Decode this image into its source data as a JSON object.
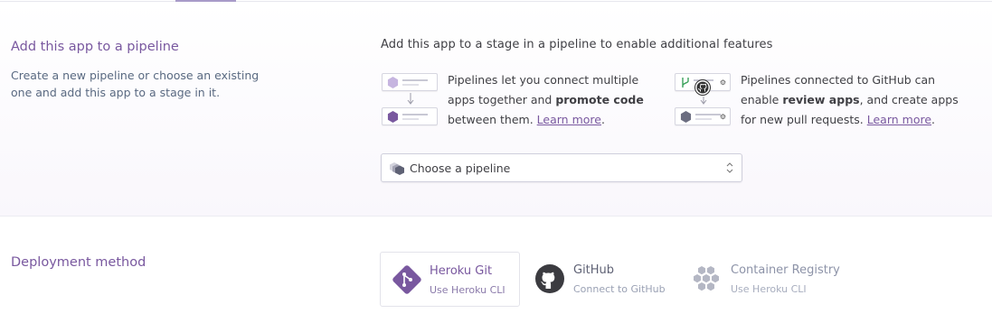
{
  "pipeline": {
    "title": "Add this app to a pipeline",
    "description": "Create a new pipeline or choose an existing one and add this app to a stage in it.",
    "stage_heading": "Add this app to a stage in a pipeline to enable additional features",
    "info_left": {
      "text_1": "Pipelines let you connect multiple apps together and ",
      "bold": "promote code",
      "text_2": " between them. ",
      "link": "Learn more",
      "end": "."
    },
    "info_right": {
      "text_1": "Pipelines connected to GitHub can enable ",
      "bold": "review apps",
      "text_2": ", and create apps for new pull requests. ",
      "link": "Learn more",
      "end": "."
    },
    "select_value": "Choose a pipeline"
  },
  "deployment": {
    "title": "Deployment method",
    "methods": [
      {
        "title": "Heroku Git",
        "subtitle": "Use Heroku CLI",
        "icon": "heroku-git-icon",
        "active": true
      },
      {
        "title": "GitHub",
        "subtitle": "Connect to GitHub",
        "icon": "github-icon",
        "active": false
      },
      {
        "title": "Container Registry",
        "subtitle": "Use Heroku CLI",
        "icon": "container-registry-icon",
        "active": false
      }
    ]
  },
  "colors": {
    "accent": "#79589f",
    "text": "#3f3f44",
    "muted": "#596981",
    "inactive": "#8d93a8"
  }
}
